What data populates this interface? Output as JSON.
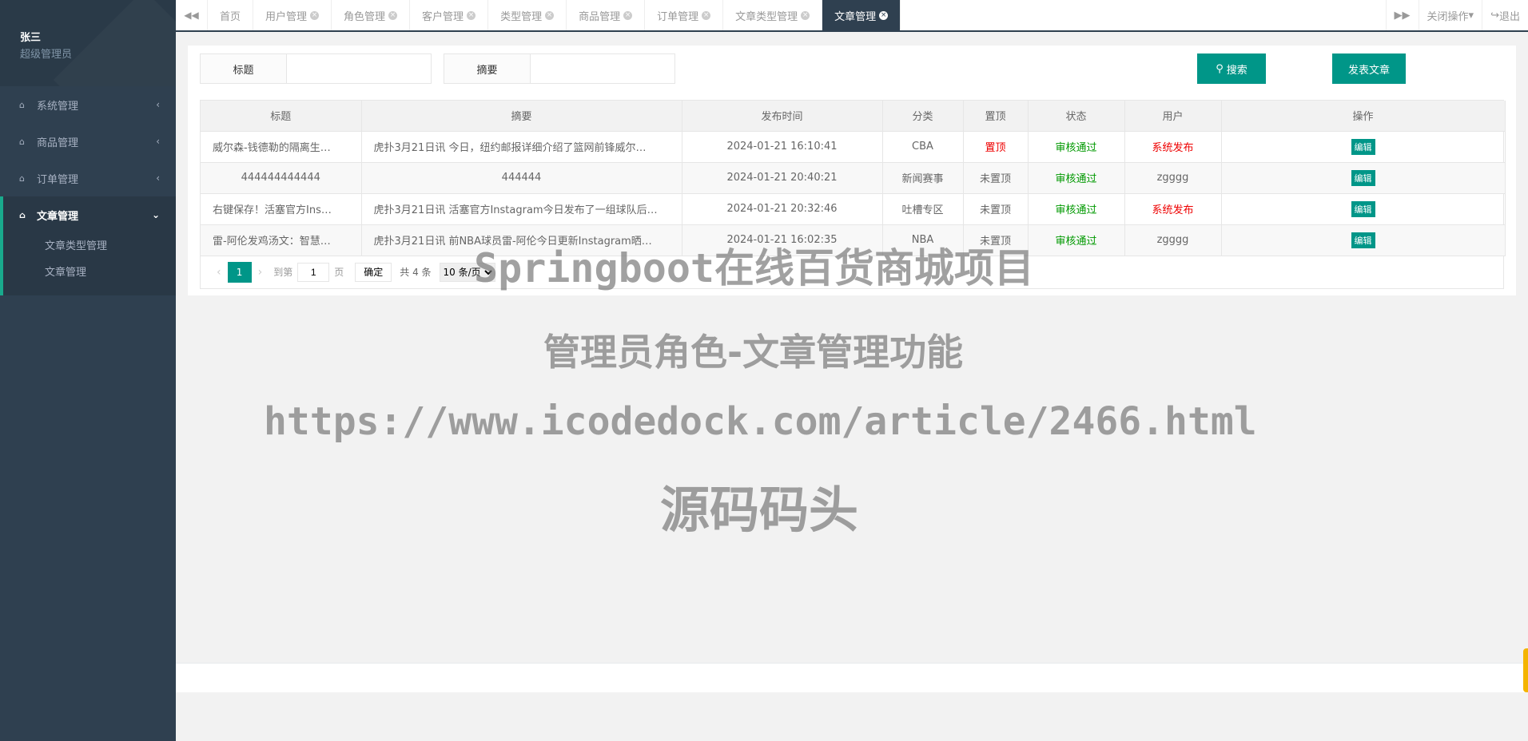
{
  "user": {
    "name": "张三",
    "role": "超级管理员"
  },
  "sidebar": {
    "items": [
      {
        "label": "系统管理",
        "arrow": "‹"
      },
      {
        "label": "商品管理",
        "arrow": "‹"
      },
      {
        "label": "订单管理",
        "arrow": "‹"
      }
    ],
    "active_group": {
      "label": "文章管理",
      "arrow": "⌄",
      "sub": [
        "文章类型管理",
        "文章管理"
      ]
    }
  },
  "topbar": {
    "prev_icon": "◀◀",
    "next_icon": "▶▶",
    "tabs": [
      "首页",
      "用户管理",
      "角色管理",
      "客户管理",
      "类型管理",
      "商品管理",
      "订单管理",
      "文章类型管理",
      "文章管理"
    ],
    "close_ops": "关闭操作",
    "logout": "退出"
  },
  "search": {
    "title_label": "标题",
    "summary_label": "摘要",
    "search_btn": "搜索",
    "post_btn": "发表文章"
  },
  "table": {
    "headers": [
      "标题",
      "摘要",
      "发布时间",
      "分类",
      "置顶",
      "状态",
      "用户",
      "操作"
    ],
    "rows": [
      {
        "title": "威尔森-钱德勒的隔离生…",
        "summary": "虎扑3月21日讯 今日，纽约邮报详细介绍了篮网前锋威尔…",
        "time": "2024-01-21 16:10:41",
        "category": "CBA",
        "top": "置顶",
        "status": "审核通过",
        "user": "系统发布",
        "action": "编辑"
      },
      {
        "title": "444444444444",
        "summary": "444444",
        "time": "2024-01-21 20:40:21",
        "category": "新闻赛事",
        "top": "未置顶",
        "status": "审核通过",
        "user": "zgggg",
        "action": "编辑"
      },
      {
        "title": "右键保存！活塞官方Ins…",
        "summary": "虎扑3月21日讯 活塞官方Instagram今日发布了一组球队后…",
        "time": "2024-01-21 20:32:46",
        "category": "吐槽专区",
        "top": "未置顶",
        "status": "审核通过",
        "user": "系统发布",
        "action": "编辑"
      },
      {
        "title": "雷-阿伦发鸡汤文：智慧…",
        "summary": "虎扑3月21日讯 前NBA球员雷-阿伦今日更新Instagram晒…",
        "time": "2024-01-21 16:02:35",
        "category": "NBA",
        "top": "未置顶",
        "status": "审核通过",
        "user": "zgggg",
        "action": "编辑"
      }
    ]
  },
  "pager": {
    "current": "1",
    "goto": "到第",
    "page_value": "1",
    "page_unit": "页",
    "confirm": "确定",
    "total": "共 4 条",
    "page_size": "10 条/页"
  },
  "watermark": {
    "line1": "Springboot在线百货商城项目",
    "line2": "管理员角色-文章管理功能",
    "line3": "https://www.icodedock.com/article/2466.html",
    "line4": "源码码头"
  },
  "colors": {
    "sidebar": "#2f4050",
    "accent": "#009688",
    "active_border": "#19aa8d"
  }
}
